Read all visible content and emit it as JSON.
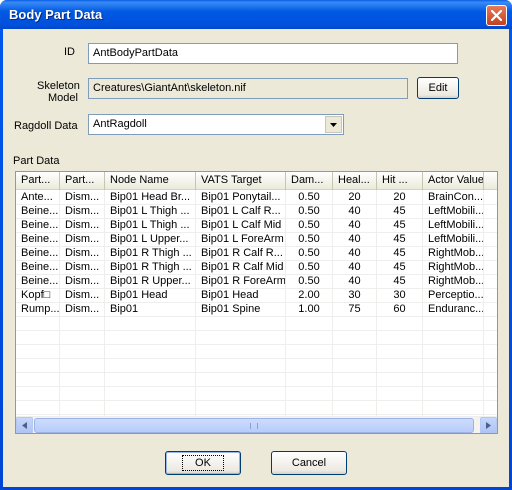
{
  "window": {
    "title": "Body Part Data"
  },
  "form": {
    "id_label": "ID",
    "id_value": "AntBodyPartData",
    "skeleton_label_line1": "Skeleton",
    "skeleton_label_line2": "Model",
    "skeleton_value": "Creatures\\GiantAnt\\skeleton.nif",
    "edit_label": "Edit",
    "ragdoll_label": "Ragdoll Data",
    "ragdoll_value": "AntRagdoll"
  },
  "part_data": {
    "label": "Part Data",
    "columns": [
      "Part...",
      "Part...",
      "Node Name",
      "VATS Target",
      "Dam...",
      "Heal...",
      "Hit ...",
      "Actor Value"
    ],
    "rows": [
      [
        "Ante...",
        "Dism...",
        "Bip01 Head Br...",
        "Bip01 Ponytail...",
        "0.50",
        "20",
        "20",
        "BrainCon..."
      ],
      [
        "Beine...",
        "Dism...",
        "Bip01 L Thigh ...",
        "Bip01 L Calf R...",
        "0.50",
        "40",
        "45",
        "LeftMobili..."
      ],
      [
        "Beine...",
        "Dism...",
        "Bip01 L Thigh ...",
        "Bip01 L Calf Mid",
        "0.50",
        "40",
        "45",
        "LeftMobili..."
      ],
      [
        "Beine...",
        "Dism...",
        "Bip01 L Upper...",
        "Bip01 L ForeArm",
        "0.50",
        "40",
        "45",
        "LeftMobili..."
      ],
      [
        "Beine...",
        "Dism...",
        "Bip01 R Thigh ...",
        "Bip01 R Calf R...",
        "0.50",
        "40",
        "45",
        "RightMob..."
      ],
      [
        "Beine...",
        "Dism...",
        "Bip01 R Thigh ...",
        "Bip01 R Calf Mid",
        "0.50",
        "40",
        "45",
        "RightMob..."
      ],
      [
        "Beine...",
        "Dism...",
        "Bip01 R Upper...",
        "Bip01 R ForeArm",
        "0.50",
        "40",
        "45",
        "RightMob..."
      ],
      [
        "Kopf□",
        "Dism...",
        "Bip01 Head",
        "Bip01 Head",
        "2.00",
        "30",
        "30",
        "Perceptio..."
      ],
      [
        "Rump...",
        "Dism...",
        "Bip01",
        "Bip01 Spine",
        "1.00",
        "75",
        "60",
        "Enduranc..."
      ]
    ]
  },
  "buttons": {
    "ok": "OK",
    "cancel": "Cancel"
  },
  "icons": {
    "close": "close-icon",
    "dropdown": "chevron-down-icon",
    "scroll_left": "arrow-left-icon",
    "scroll_right": "arrow-right-icon"
  }
}
